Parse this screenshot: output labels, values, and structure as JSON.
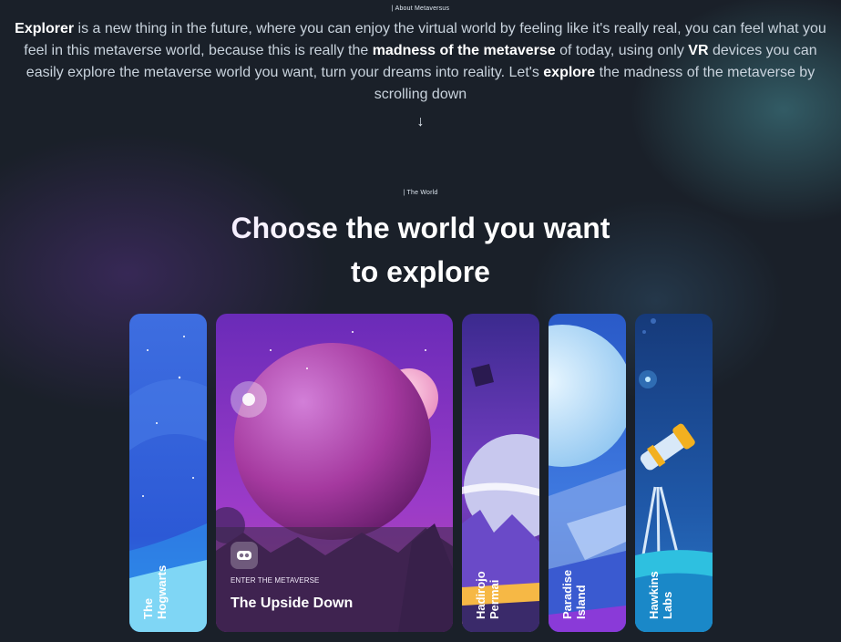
{
  "about": {
    "tag": "| About Metaversus",
    "segments": [
      {
        "text": "Explorer",
        "bold": true
      },
      {
        "text": " is a new thing in the future, where you can enjoy the virtual world by feeling like it's really real, you can feel what you feel in this metaverse world, because this is really the ",
        "bold": false
      },
      {
        "text": "madness of the metaverse",
        "bold": true
      },
      {
        "text": " of today, using only ",
        "bold": false
      },
      {
        "text": "VR",
        "bold": true
      },
      {
        "text": " devices you can easily explore the metaverse world you want, turn your dreams into reality. Let's ",
        "bold": false
      },
      {
        "text": "explore",
        "bold": true
      },
      {
        "text": " the madness of the metaverse by scrolling down",
        "bold": false
      }
    ],
    "arrow": "↓"
  },
  "world": {
    "tag": "| The World",
    "heading_line1": "Choose the world you want",
    "heading_line2": "to explore"
  },
  "cards": [
    {
      "label": "The\nHogwarts"
    },
    {
      "label": "The Upside Down",
      "enter_text": "ENTER THE METAVERSE",
      "active": true
    },
    {
      "label": "Hadirojo\nPermai"
    },
    {
      "label": "Paradise\nIsland"
    },
    {
      "label": "Hawkins\nLabs"
    }
  ],
  "icons": {
    "vr": "vr-headset-icon",
    "arrow": "arrow-down-icon"
  }
}
